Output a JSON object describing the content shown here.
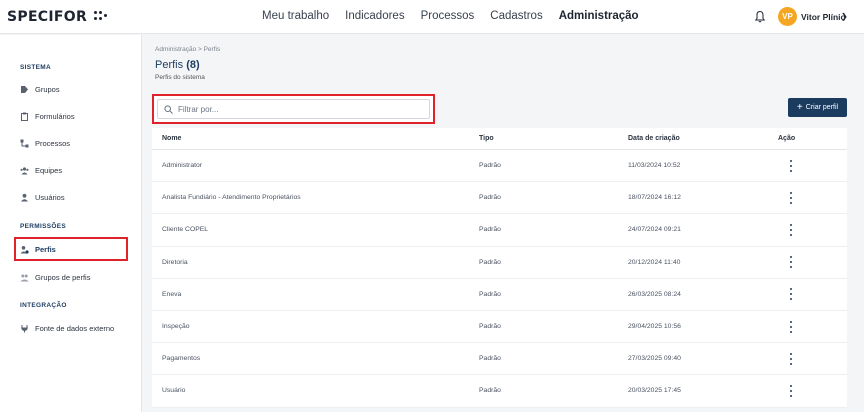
{
  "app": {
    "logo": "SPECIFOR"
  },
  "nav": [
    {
      "label": "Meu trabalho",
      "active": false
    },
    {
      "label": "Indicadores",
      "active": false
    },
    {
      "label": "Processos",
      "active": false
    },
    {
      "label": "Cadastros",
      "active": false
    },
    {
      "label": "Administração",
      "active": true
    }
  ],
  "user": {
    "initials": "VP",
    "name": "Vitor Plínio",
    "avatar_color": "#f5a623"
  },
  "sidebar": {
    "sections": [
      {
        "title": "SISTEMA"
      },
      {
        "title": "PERMISSÕES"
      },
      {
        "title": "INTEGRAÇÃO"
      }
    ],
    "items": [
      {
        "label": "Grupos",
        "icon": "tag-icon"
      },
      {
        "label": "Formulários",
        "icon": "clipboard-icon"
      },
      {
        "label": "Processos",
        "icon": "flow-icon"
      },
      {
        "label": "Equipes",
        "icon": "team-icon"
      },
      {
        "label": "Usuários",
        "icon": "user-icon"
      },
      {
        "label": "Perfis",
        "icon": "profile-icon",
        "active": true
      },
      {
        "label": "Grupos de perfis",
        "icon": "profile-group-icon"
      },
      {
        "label": "Fonte de dados externo",
        "icon": "plug-icon"
      }
    ]
  },
  "main": {
    "breadcrumb": "Administração  >  Perfis",
    "title": "Perfis",
    "count": "(8)",
    "subtitle": "Perfis do sistema",
    "search_placeholder": "Filtrar por...",
    "create_label": "Criar perfil"
  },
  "table": {
    "columns": [
      "Nome",
      "Tipo",
      "Data de criação",
      "Ação"
    ],
    "rows": [
      {
        "nome": "Administrator",
        "tipo": "Padrão",
        "data": "11/03/2024 10:52"
      },
      {
        "nome": "Analista Fundiário - Atendimento Proprietários",
        "tipo": "Padrão",
        "data": "18/07/2024 16:12"
      },
      {
        "nome": "Cliente COPEL",
        "tipo": "Padrão",
        "data": "24/07/2024 09:21"
      },
      {
        "nome": "Diretoria",
        "tipo": "Padrão",
        "data": "20/12/2024 11:40"
      },
      {
        "nome": "Eneva",
        "tipo": "Padrão",
        "data": "26/03/2025 08:24"
      },
      {
        "nome": "Inspeção",
        "tipo": "Padrão",
        "data": "29/04/2025 10:56"
      },
      {
        "nome": "Pagamentos",
        "tipo": "Padrão",
        "data": "27/03/2025 09:40"
      },
      {
        "nome": "Usuário",
        "tipo": "Padrão",
        "data": "20/03/2025 17:45"
      }
    ]
  },
  "colors": {
    "primary": "#1b3b5f",
    "highlight": "#e0232a"
  }
}
